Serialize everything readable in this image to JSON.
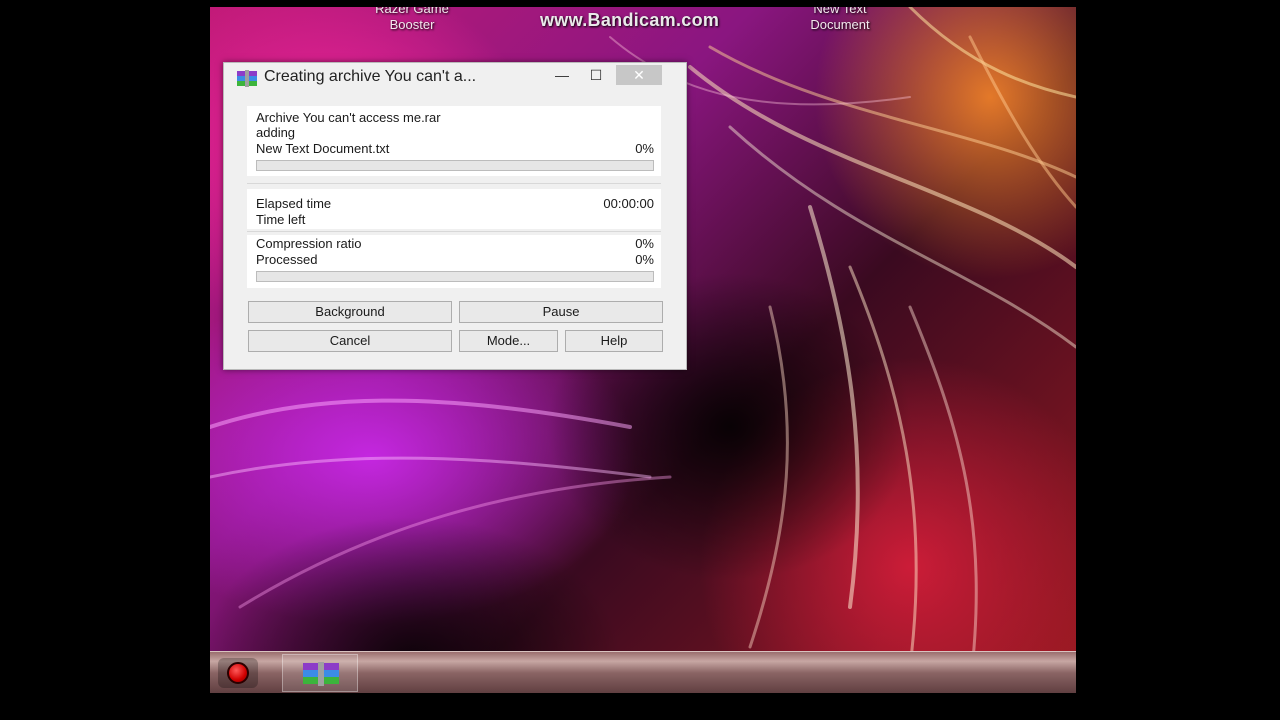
{
  "desktop": {
    "watermark": "www.Bandicam.com",
    "icon_left_label": "Razer Game\nBooster",
    "icon_left_label_line1": "Razer Game",
    "icon_left_label_line2": "Booster",
    "icon_right_label_line1": "New Text",
    "icon_right_label_line2": "Document"
  },
  "dialog": {
    "title": "Creating archive You can't a...",
    "archive_line": "Archive You can't access me.rar",
    "action_line": "adding",
    "current_file": "New Text Document.txt",
    "current_file_percent": "0%",
    "current_file_progress": 0,
    "elapsed_label": "Elapsed time",
    "elapsed_value": "00:00:00",
    "time_left_label": "Time left",
    "compression_label": "Compression ratio",
    "compression_value": "0%",
    "processed_label": "Processed",
    "processed_value": "0%",
    "processed_progress": 0,
    "buttons": {
      "background": "Background",
      "pause": "Pause",
      "cancel": "Cancel",
      "mode": "Mode...",
      "help": "Help"
    },
    "window_controls": {
      "minimize": "—",
      "maximize": "☐",
      "close": "✕"
    }
  },
  "taskbar": {
    "record_icon": "record-icon",
    "app_icon": "winrar-icon"
  },
  "colors": {
    "progress_fill": "#06b025",
    "close_button": "#c7c7c7",
    "record_red": "#d00000"
  }
}
